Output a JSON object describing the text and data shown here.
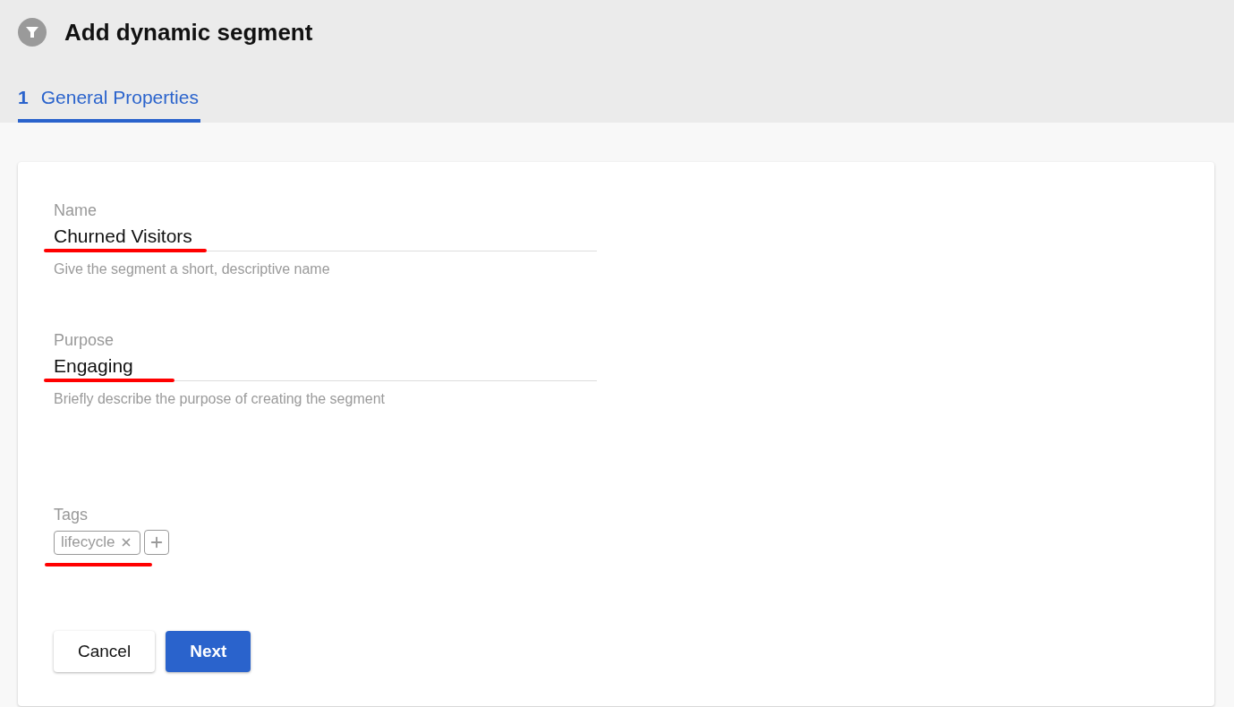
{
  "header": {
    "title": "Add dynamic segment"
  },
  "tabs": [
    {
      "number": "1",
      "label": "General Properties",
      "selected": true
    }
  ],
  "fields": [
    {
      "kind": "text",
      "label": "Name",
      "value": "Churned Visitors",
      "hint": "Give the segment a short, descriptive name"
    },
    {
      "kind": "text",
      "label": "Purpose",
      "value": "Engaging",
      "hint": "Briefly describe the purpose of creating the segment"
    },
    {
      "kind": "tags",
      "label": "Tags",
      "tags": [
        "lifecycle"
      ]
    }
  ],
  "buttons": [
    {
      "label": "Cancel",
      "kind": "secondary"
    },
    {
      "label": "Next",
      "kind": "primary"
    }
  ]
}
